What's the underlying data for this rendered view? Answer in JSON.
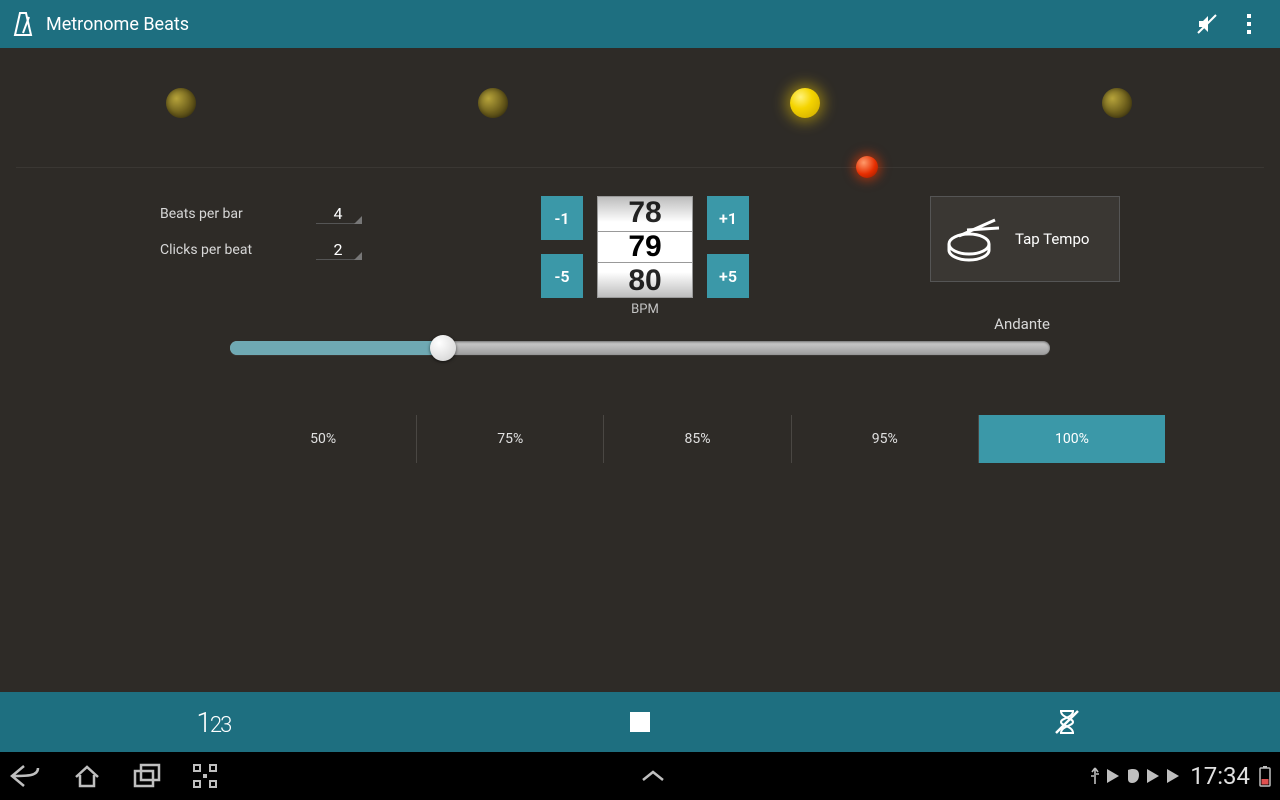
{
  "appbar": {
    "title": "Metronome Beats"
  },
  "icons": {
    "mute": "mute-icon",
    "overflow": "overflow-icon",
    "metronome": "metronome-icon"
  },
  "beats": {
    "count": 4,
    "active_index": 2
  },
  "settings": {
    "beats_per_bar_label": "Beats per bar",
    "beats_per_bar": "4",
    "clicks_per_beat_label": "Clicks per beat",
    "clicks_per_beat": "2"
  },
  "bpm": {
    "prev": "78",
    "current": "79",
    "next": "80",
    "unit": "BPM",
    "minus1": "-1",
    "plus1": "+1",
    "minus5": "-5",
    "plus5": "+5"
  },
  "tap": {
    "label": "Tap Tempo"
  },
  "tempo_name": "Andante",
  "slider": {
    "fill_pct": 26,
    "thumb_pct": 26
  },
  "percents": {
    "items": [
      "50%",
      "75%",
      "85%",
      "95%",
      "100%"
    ],
    "active_index": 4
  },
  "actionbar": {
    "count_label_big": "1",
    "count_label_small": "23"
  },
  "statusbar": {
    "time": "17:34"
  }
}
